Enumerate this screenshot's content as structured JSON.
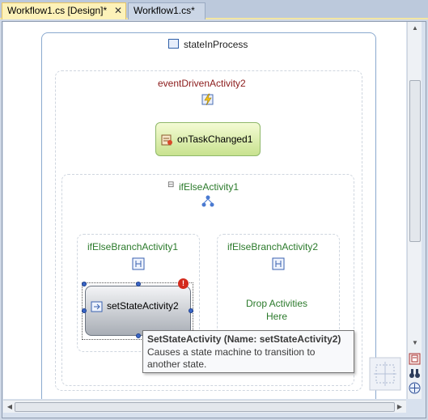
{
  "tabs": [
    {
      "label": "Workflow1.cs [Design]*",
      "active": true,
      "close": "✕"
    },
    {
      "label": "Workflow1.cs*",
      "active": false
    }
  ],
  "workflow": {
    "state_title": "stateInProcess",
    "event_driven_label": "eventDrivenActivity2",
    "on_task_changed_label": "onTaskChanged1",
    "if_else_label": "ifElseActivity1",
    "branch1_label": "ifElseBranchActivity1",
    "branch2_label": "ifElseBranchActivity2",
    "set_state_label": "setStateActivity2",
    "drop_line1": "Drop Activities",
    "drop_line2": "Here",
    "error_glyph": "!"
  },
  "tooltip": {
    "title": "SetStateActivity (Name: setStateActivity2)",
    "body": "Causes a state machine to transition to another state."
  },
  "icons": {
    "collapse": "⊟",
    "scroll_up": "▲",
    "scroll_down": "▼",
    "scroll_left": "◀",
    "scroll_right": "▶"
  },
  "colors": {
    "flow_red": "#8b1a1a",
    "flow_green": "#2b7a2b",
    "accent_tab": "#fdf2b9",
    "error": "#d32a1c"
  }
}
